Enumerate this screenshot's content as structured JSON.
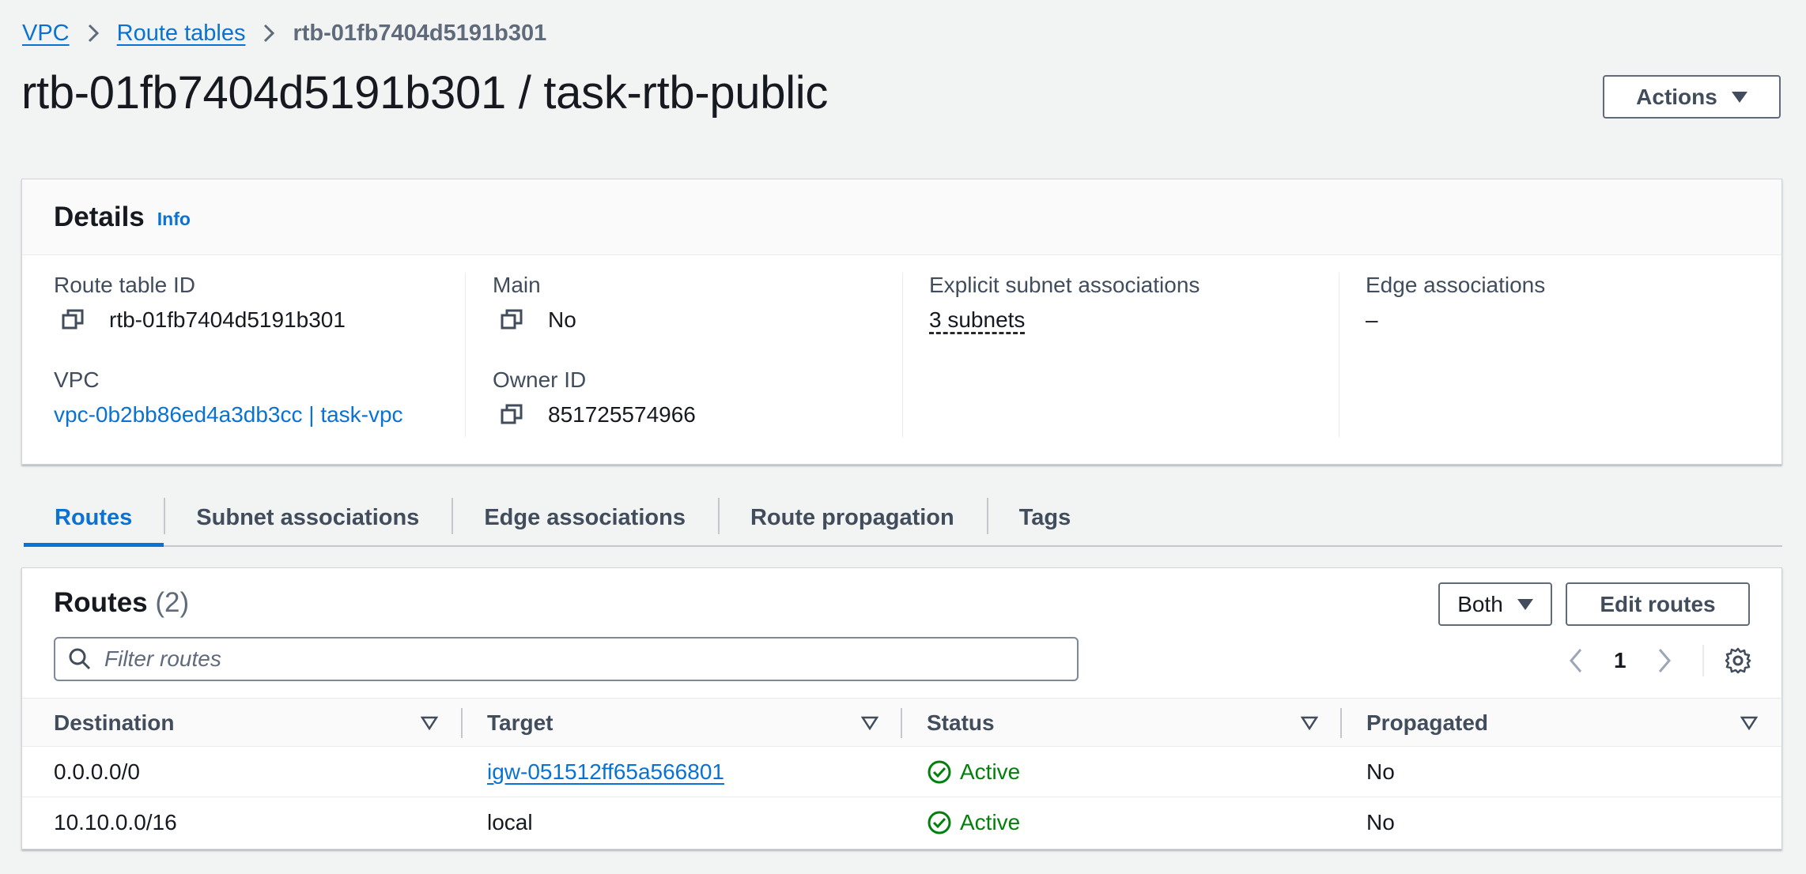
{
  "breadcrumb": {
    "items": [
      "VPC",
      "Route tables"
    ],
    "current": "rtb-01fb7404d5191b301"
  },
  "page": {
    "title": "rtb-01fb7404d5191b301 / task-rtb-public",
    "actions_label": "Actions"
  },
  "details": {
    "title": "Details",
    "info_label": "Info",
    "route_table_id_label": "Route table ID",
    "route_table_id_value": "rtb-01fb7404d5191b301",
    "vpc_label": "VPC",
    "vpc_value": "vpc-0b2bb86ed4a3db3cc | task-vpc",
    "main_label": "Main",
    "main_value": "No",
    "owner_id_label": "Owner ID",
    "owner_id_value": "851725574966",
    "explicit_subnet_label": "Explicit subnet associations",
    "explicit_subnet_value": "3 subnets",
    "edge_assoc_label": "Edge associations",
    "edge_assoc_value": "–"
  },
  "tabs": [
    {
      "label": "Routes",
      "active": true
    },
    {
      "label": "Subnet associations",
      "active": false
    },
    {
      "label": "Edge associations",
      "active": false
    },
    {
      "label": "Route propagation",
      "active": false
    },
    {
      "label": "Tags",
      "active": false
    }
  ],
  "routes": {
    "title": "Routes",
    "count": "(2)",
    "filter_selected": "Both",
    "edit_label": "Edit routes",
    "search_placeholder": "Filter routes",
    "page": "1",
    "columns": [
      "Destination",
      "Target",
      "Status",
      "Propagated"
    ],
    "rows": [
      {
        "destination": "0.0.0.0/0",
        "target": "igw-051512ff65a566801",
        "target_is_link": true,
        "status": "Active",
        "propagated": "No"
      },
      {
        "destination": "10.10.0.0/16",
        "target": "local",
        "target_is_link": false,
        "status": "Active",
        "propagated": "No"
      }
    ]
  },
  "colors": {
    "link": "#0972d3",
    "success": "#037f0c",
    "text": "#16191f",
    "muted": "#5f6b7a"
  }
}
